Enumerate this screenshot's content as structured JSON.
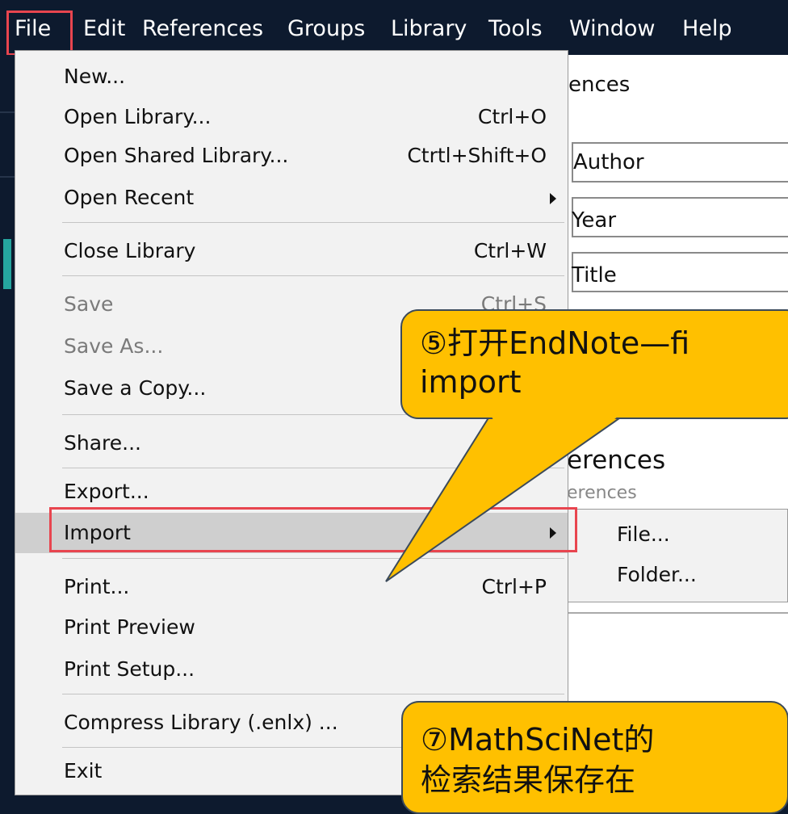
{
  "menubar": {
    "items": [
      "File",
      "Edit",
      "References",
      "Groups",
      "Library",
      "Tools",
      "Window",
      "Help"
    ]
  },
  "file_menu": {
    "items": [
      {
        "label": "New...",
        "shortcut": ""
      },
      {
        "label": "Open Library...",
        "shortcut": "Ctrl+O"
      },
      {
        "label": "Open Shared Library...",
        "shortcut": "Ctrtl+Shift+O"
      },
      {
        "label": "Open Recent",
        "shortcut": ""
      },
      {
        "label": "Close Library",
        "shortcut": "Ctrl+W"
      },
      {
        "label": "Save",
        "shortcut": "Ctrl+S"
      },
      {
        "label": "Save As...",
        "shortcut": ""
      },
      {
        "label": "Save a Copy...",
        "shortcut": ""
      },
      {
        "label": "Share...",
        "shortcut": ""
      },
      {
        "label": "Export...",
        "shortcut": ""
      },
      {
        "label": "Import",
        "shortcut": ""
      },
      {
        "label": "Print...",
        "shortcut": "Ctrl+P"
      },
      {
        "label": "Print Preview",
        "shortcut": ""
      },
      {
        "label": "Print Setup...",
        "shortcut": ""
      },
      {
        "label": "Compress Library (.enlx) ...",
        "shortcut": ""
      },
      {
        "label": "Exit",
        "shortcut": ""
      }
    ]
  },
  "import_submenu": {
    "items": [
      "File...",
      "Folder..."
    ]
  },
  "background": {
    "heading_partial": "ences",
    "field_author": "Author",
    "field_year": "Year",
    "field_title": "Title",
    "references_partial": "erences",
    "references_sub_partial": "erences"
  },
  "callouts": {
    "step5_line1": "⑤打开EndNote—fi",
    "step5_line2": "import",
    "step7_line1": "⑦MathSciNet的",
    "step7_line2": "检索结果保存在"
  },
  "colors": {
    "menubar_bg": "#0d1a2e",
    "menu_bg": "#f2f2f2",
    "highlight": "#cfcfcf",
    "annotation_red": "#e8454f",
    "callout_yellow": "#ffc000"
  }
}
